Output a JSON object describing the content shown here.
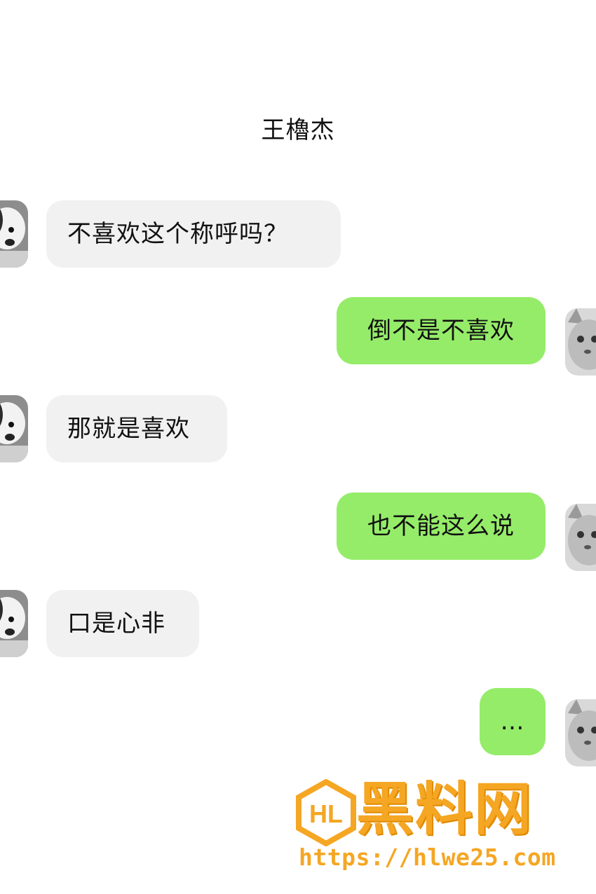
{
  "header": {
    "contact_name": "王櫓杰"
  },
  "messages": [
    {
      "side": "in",
      "text": "不喜欢这个称呼吗？"
    },
    {
      "side": "out",
      "text": "倒不是不喜欢"
    },
    {
      "side": "in",
      "text": "那就是喜欢"
    },
    {
      "side": "out",
      "text": "也不能这么说"
    },
    {
      "side": "in",
      "text": "口是心非"
    },
    {
      "side": "out",
      "text": "…"
    }
  ],
  "avatars": {
    "incoming": "dog-avatar-icon",
    "outgoing": "cat-avatar-icon"
  },
  "watermark": {
    "title": "黑料网",
    "url": "https://hlwe25.com"
  },
  "colors": {
    "incoming_bubble": "#f1f1f1",
    "outgoing_bubble": "#95ec69",
    "watermark": "#f5a623"
  }
}
